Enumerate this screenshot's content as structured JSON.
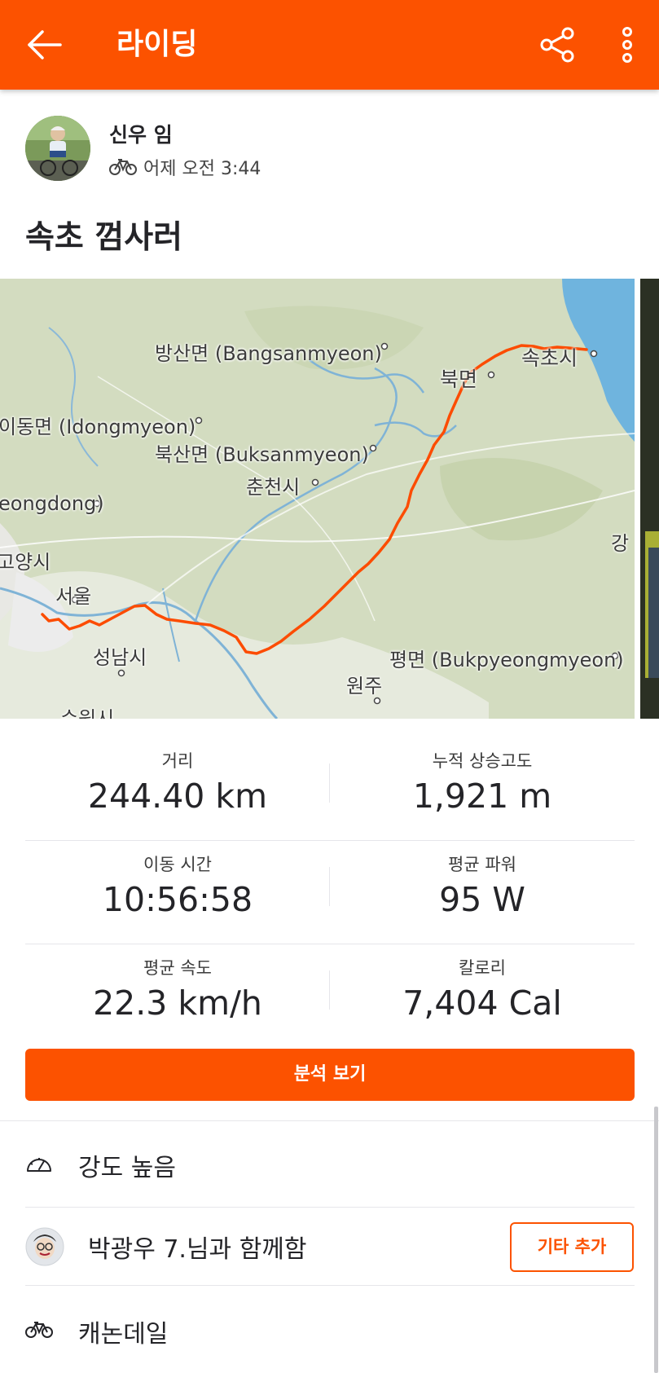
{
  "app_bar": {
    "title": "라이딩"
  },
  "athlete": {
    "name": "신우 임",
    "timestamp": "어제 오전 3:44"
  },
  "activity": {
    "title": "속초 껌사러"
  },
  "map": {
    "labels": {
      "bangsan": "방산면 (Bangsanmyeon)",
      "idong": "이동면 (Idongmyeon)",
      "buksan": "북산면 (Buksanmyeon)",
      "chuncheon": "춘천시",
      "sokcho": "속초시",
      "bukmyeon": "북면",
      "eongdong": "eongdong)",
      "goyang": "고양시",
      "seoul": "서울",
      "seongnam": "성남시",
      "bukpyeong": "평면 (Bukpyeongmyeon)",
      "wonju": "원주",
      "suwon": "수원시",
      "gang": "강"
    },
    "colors": {
      "route": "#fc4c02",
      "land": "#dfe5cf",
      "water": "#6fb4de"
    }
  },
  "stats": [
    {
      "label": "거리",
      "value": "244.40 km"
    },
    {
      "label": "누적 상승고도",
      "value": "1,921 m"
    },
    {
      "label": "이동 시간",
      "value": "10:56:58"
    },
    {
      "label": "평균 파워",
      "value": "95 W"
    },
    {
      "label": "평균 속도",
      "value": "22.3 km/h"
    },
    {
      "label": "칼로리",
      "value": "7,404 Cal"
    }
  ],
  "actions": {
    "analysis_label": "분석 보기"
  },
  "details": {
    "intensity": "강도 높음",
    "with_athletes": "박광우 7.님과 함께함",
    "add_others_label": "기타 추가",
    "bike": "캐논데일"
  },
  "theme": {
    "accent": "#fc5200",
    "text": "#242428",
    "divider": "#e6e6ea"
  }
}
